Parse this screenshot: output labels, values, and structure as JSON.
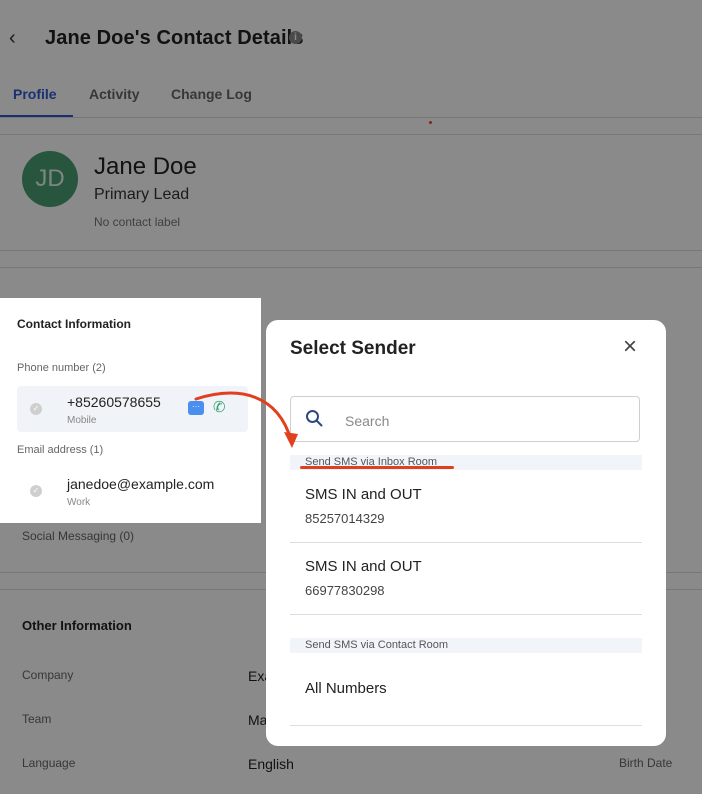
{
  "header": {
    "back_glyph": "‹",
    "title": "Jane Doe's Contact Details",
    "info_glyph": "i"
  },
  "tabs": [
    {
      "label": "Profile",
      "active": true
    },
    {
      "label": "Activity",
      "active": false
    },
    {
      "label": "Change Log",
      "active": false
    }
  ],
  "profile": {
    "initials": "JD",
    "name": "Jane Doe",
    "role": "Primary Lead",
    "contact_label": "No contact label"
  },
  "background": {
    "social_messaging": "Social Messaging (0)",
    "other_information": "Other Information",
    "fields": [
      {
        "label": "Company",
        "value": "Exa"
      },
      {
        "label": "Team",
        "value": "Ma"
      },
      {
        "label": "Language",
        "value": "English"
      }
    ],
    "birth_date_label": "Birth Date"
  },
  "contact_panel": {
    "title": "Contact Information",
    "phone_header": "Phone number (2)",
    "phone": {
      "number": "+85260578655",
      "type": "Mobile"
    },
    "email_header": "Email address (1)",
    "email": {
      "address": "janedoe@example.com",
      "type": "Work"
    },
    "check_glyph": "✓",
    "sms_glyph": "···",
    "call_glyph": "✆"
  },
  "modal": {
    "title": "Select Sender",
    "close_glyph": "×",
    "search_placeholder": "Search",
    "group_inbox": "Send SMS via Inbox Room",
    "inbox_options": [
      {
        "name": "SMS IN and OUT",
        "number": "85257014329"
      },
      {
        "name": "SMS IN and OUT",
        "number": "66977830298"
      }
    ],
    "group_contact": "Send SMS via Contact Room",
    "contact_options": [
      {
        "name": "All Numbers"
      }
    ]
  },
  "colors": {
    "accent": "#2f5bd6",
    "avatar": "#4a9d73",
    "annotation": "#e0401e",
    "overlay": "rgba(0,0,0,0.46)"
  }
}
